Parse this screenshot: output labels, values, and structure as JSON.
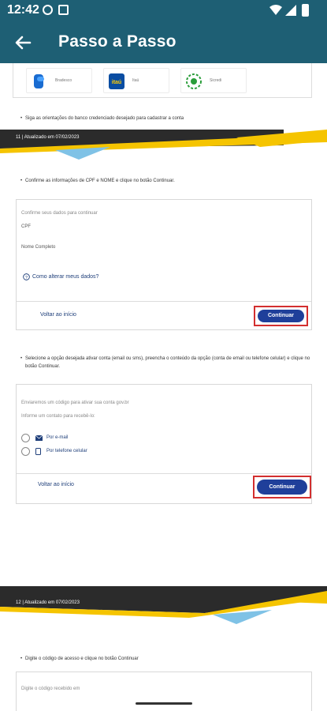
{
  "status_bar": {
    "time": "12:42"
  },
  "app_bar": {
    "title": "Passo a Passo"
  },
  "banks": [
    {
      "name": "Bradesco",
      "color": "#1a6cd1"
    },
    {
      "name": "Itaú",
      "color": "#0a4da2"
    },
    {
      "name": "Sicredi",
      "color": "#2a9d3a"
    }
  ],
  "steps": {
    "step1": "Siga as orientações do banco credenciado desejado para cadastrar a conta",
    "page11": "11  |  Atualizado em 07/02/2023",
    "step2": "Confirme as informações de CPF e NOME e clique no botão Continuar.",
    "card1": {
      "hint": "Confirme seus dados para continuar",
      "cpf_label": "CPF",
      "name_label": "Nome Completo",
      "help_link": "Como alterar meus dados?",
      "back_link": "Voltar ao início",
      "continue": "Continuar"
    },
    "step3": "Selecione a opção desejada ativar conta (email ou sms), preencha o conteúdo da opção (conta de email ou telefone celular) e clique no botão Continuar.",
    "card2": {
      "hint1": "Enviaremos um código para ativar sua conta gov.br",
      "hint2": "Informe um contato para recebê-lo:",
      "opt_email": "Por e-mail",
      "opt_phone": "Por telefone celular",
      "back_link": "Voltar ao início",
      "continue": "Continuar"
    },
    "page12": "12  |  Atualizado em 07/02/2023",
    "step4": "Digite o código de acesso e clique no botão Continuar",
    "card3": {
      "hint": "Digite o código recebido em"
    }
  }
}
